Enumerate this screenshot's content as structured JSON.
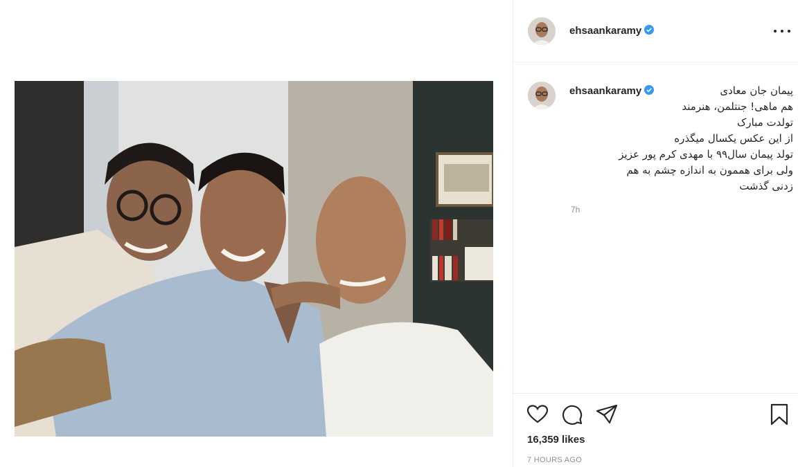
{
  "post": {
    "username": "ehsaankaramy",
    "verified": true,
    "caption_lines": [
      "پیمان جان معادی",
      "هم ماهی! جنتلمن، هنرمند",
      "تولدت مبارک",
      "از این عکس یکسال میگذره",
      "تولد پیمان سال۹۹ با مهدی کرم پور عزیز",
      "ولی برای هممون به اندازه چشم به هم",
      "زدنی گذشت"
    ],
    "caption_age": "7h",
    "likes": "16,359 likes",
    "timestamp": "7 HOURS AGO"
  },
  "icons": {
    "more": "more-options-icon",
    "like": "heart-icon",
    "comment": "comment-icon",
    "share": "share-icon",
    "save": "bookmark-icon",
    "verified": "verified-badge-icon"
  },
  "colors": {
    "verified_blue": "#3897f0",
    "text": "#262626",
    "muted": "#8e8e8e",
    "border": "#efefef"
  }
}
